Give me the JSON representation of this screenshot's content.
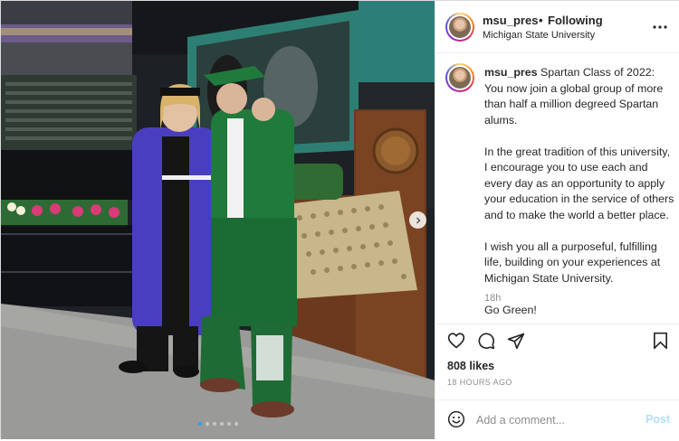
{
  "header": {
    "username": "msu_pres",
    "separator": "•",
    "follow_status": "Following",
    "location": "Michigan State University",
    "more_icon": "more-horizontal-icon"
  },
  "caption": {
    "username": "msu_pres",
    "paragraphs": [
      "Spartan Class of 2022: You now join a global group of more than half a million degreed Spartan alums.",
      "In the great tradition of this university, I encourage you to use each and every day as an opportunity to apply your education in the service of others and to make the world a better place.",
      "I wish you all a purposeful, fulfilling life, building on your experiences at Michigan State University.",
      "Go Green!"
    ],
    "timestamp": "18h"
  },
  "actions": {
    "icons": [
      "heart-icon",
      "comment-icon",
      "share-icon",
      "bookmark-icon"
    ],
    "likes": "808 likes",
    "posted": "18 HOURS AGO"
  },
  "comment": {
    "placeholder": "Add a comment...",
    "post_label": "Post",
    "emoji_icon": "emoji-icon"
  },
  "carousel": {
    "total": 6,
    "active_index": 0
  },
  "colors": {
    "accent": "#0095f6",
    "post_disabled": "#b2dffc",
    "msu_green": "#18453b",
    "gown_green": "#1f7a3c",
    "gown_purple": "#4b3fb8"
  }
}
